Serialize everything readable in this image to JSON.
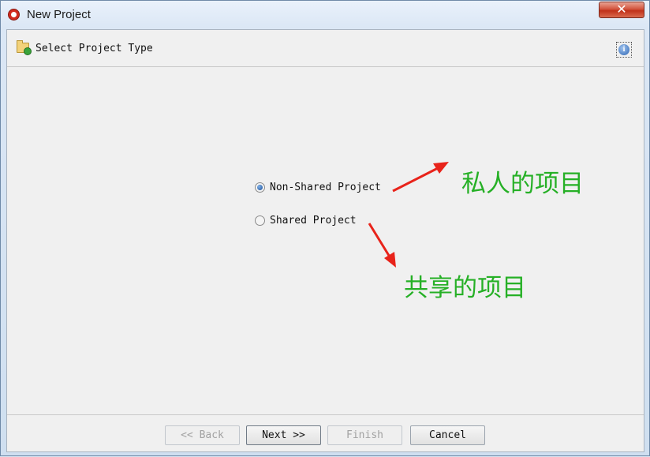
{
  "window": {
    "title": "New Project",
    "close_glyph": "✕"
  },
  "header": {
    "title": "Select Project Type",
    "icon": "project-folder-icon",
    "info_glyph": "i"
  },
  "options": [
    {
      "label": "Non-Shared Project",
      "selected": true
    },
    {
      "label": "Shared Project",
      "selected": false
    }
  ],
  "annotations": {
    "private_label": "私人的项目",
    "shared_label": "共享的项目",
    "color": "#26b026",
    "arrow_color": "#e8231a"
  },
  "buttons": {
    "back": "<< Back",
    "next": "Next >>",
    "finish": "Finish",
    "cancel": "Cancel"
  }
}
